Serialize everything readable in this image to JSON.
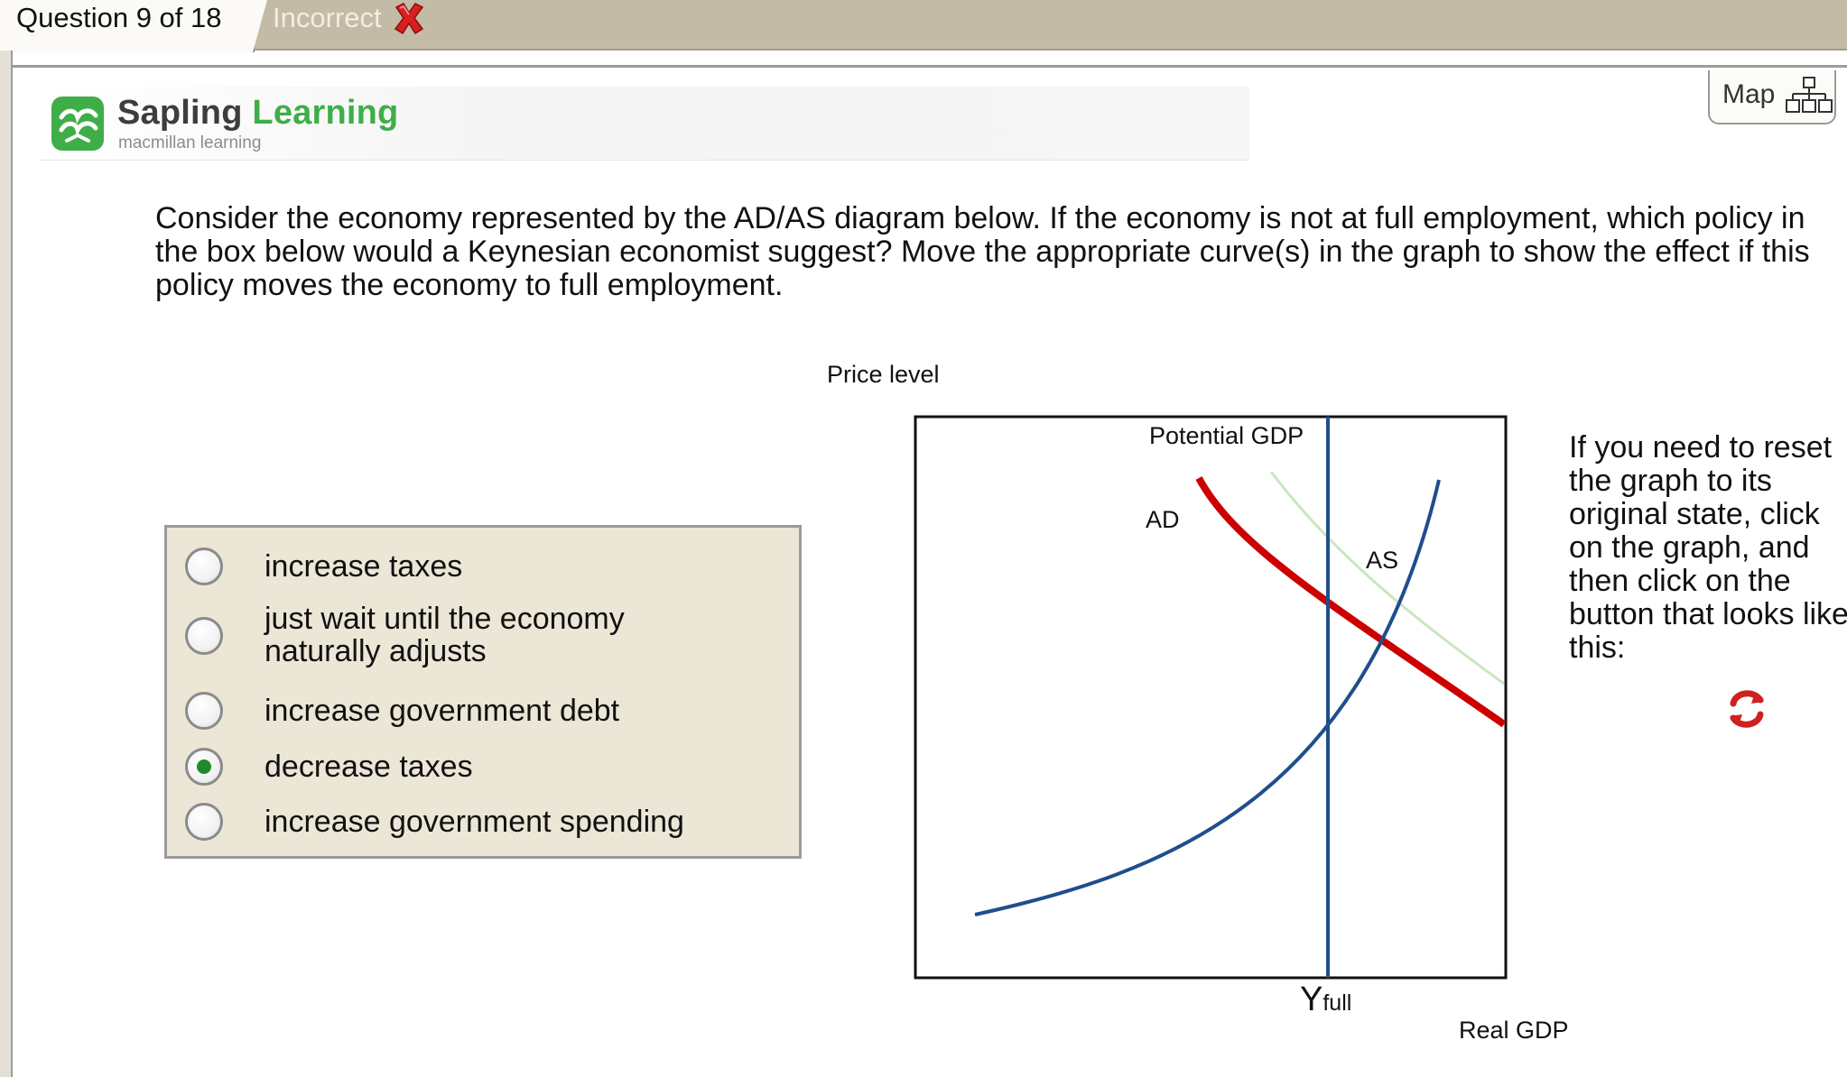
{
  "tabs": {
    "question_label": "Question 9 of 18",
    "status_label": "Incorrect",
    "status_icon": "red-x-icon"
  },
  "header": {
    "brand_part1": "Sapling",
    "brand_part2": "Learning",
    "brand_sub": "macmillan learning",
    "map_label": "Map"
  },
  "question": {
    "text": "Consider the economy represented by the AD/AS diagram below. If the economy is not at full employment, which policy in the box below would a Keynesian economist suggest?  Move the appropriate curve(s) in the graph to show the effect if this policy moves the economy to full employment."
  },
  "answers": {
    "options": [
      {
        "label": "increase taxes",
        "selected": false
      },
      {
        "label": "just wait until the economy naturally adjusts",
        "selected": false
      },
      {
        "label": "increase government debt",
        "selected": false
      },
      {
        "label": "decrease taxes",
        "selected": true
      },
      {
        "label": "increase government spending",
        "selected": false
      }
    ]
  },
  "graph": {
    "y_axis_label": "Price level",
    "x_axis_label": "Real GDP",
    "potential_label": "Potential GDP",
    "ad_label": "AD",
    "as_label": "AS",
    "yfull_main": "Y",
    "yfull_sub": "full",
    "colors": {
      "ad": "#cc0000",
      "ad_ghost": "#c9e6c0",
      "as": "#1f4e8c",
      "potential": "#1f4e8c"
    }
  },
  "reset_help": {
    "text": "If you need to reset the graph to its original state, click on the graph, and then click on the button that looks like this:",
    "icon": "reset-icon"
  }
}
